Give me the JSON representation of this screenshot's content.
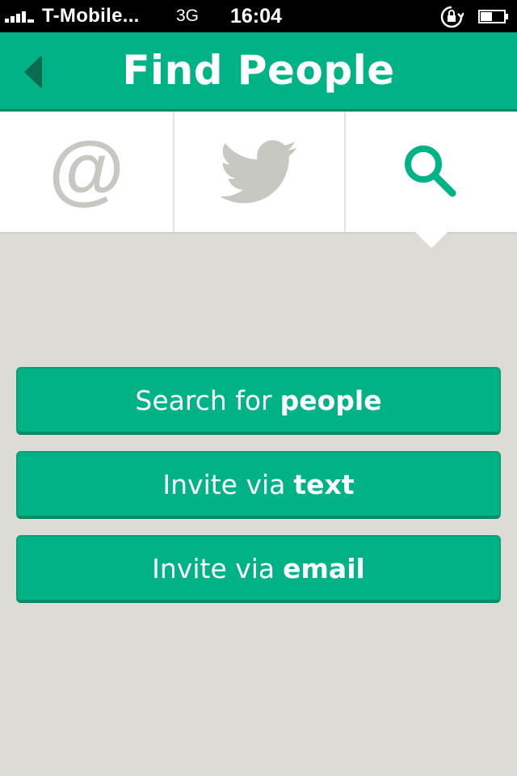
{
  "status_bar": {
    "carrier": "T-Mobile...",
    "network": "3G",
    "time": "16:04"
  },
  "header": {
    "title": "Find People"
  },
  "tabs": [
    {
      "name": "at",
      "glyph": "@",
      "icon": "at-icon",
      "active": false
    },
    {
      "name": "twitter",
      "icon": "twitter-bird-icon",
      "active": false
    },
    {
      "name": "search",
      "icon": "search-icon",
      "active": true
    }
  ],
  "actions": [
    {
      "prefix": "Search for",
      "bold": "people"
    },
    {
      "prefix": "Invite via",
      "bold": "text"
    },
    {
      "prefix": "Invite via",
      "bold": "email"
    }
  ],
  "colors": {
    "accent": "#00b386",
    "accent_dark": "#0a8a66",
    "inactive_icon": "#c8c8c3",
    "background": "#dcdbd5"
  }
}
